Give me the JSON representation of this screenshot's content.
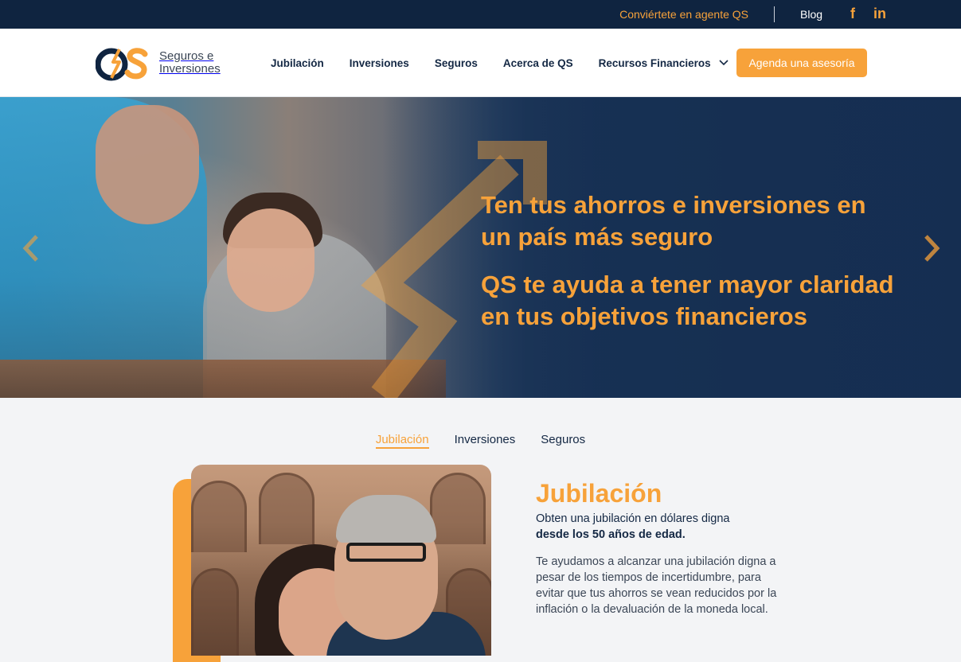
{
  "topbar": {
    "agent_link": "Conviértete en agente QS",
    "blog_link": "Blog",
    "facebook_glyph": "f",
    "linkedin_glyph": "in"
  },
  "header": {
    "logo_mark": "QS",
    "logo_text": "Seguros e Inversiones",
    "nav": [
      {
        "label": "Jubilación"
      },
      {
        "label": "Inversiones"
      },
      {
        "label": "Seguros"
      },
      {
        "label": "Acerca de QS"
      },
      {
        "label": "Recursos Financieros",
        "has_dropdown": true
      }
    ],
    "cta": "Agenda una asesoría"
  },
  "hero": {
    "headline": "Ten tus ahorros e inversiones en un país más seguro",
    "subline": "QS te ayuda a tener mayor claridad en tus objetivos financieros"
  },
  "tabs": [
    {
      "label": "Jubilación",
      "active": true
    },
    {
      "label": "Inversiones",
      "active": false
    },
    {
      "label": "Seguros",
      "active": false
    }
  ],
  "content": {
    "title": "Jubilación",
    "lead": "Obten una jubilación en dólares digna",
    "lead_bold": "desde los 50 años de edad.",
    "body": "Te ayudamos a alcanzar una jubilación digna a pesar de los tiempos de incertidumbre, para evitar que tus ahorros se vean reducidos por la inflación o la devaluación de la moneda local."
  },
  "colors": {
    "brand_orange": "#f7a23a",
    "brand_navy": "#0f2440",
    "background": "#f3f4f6"
  }
}
